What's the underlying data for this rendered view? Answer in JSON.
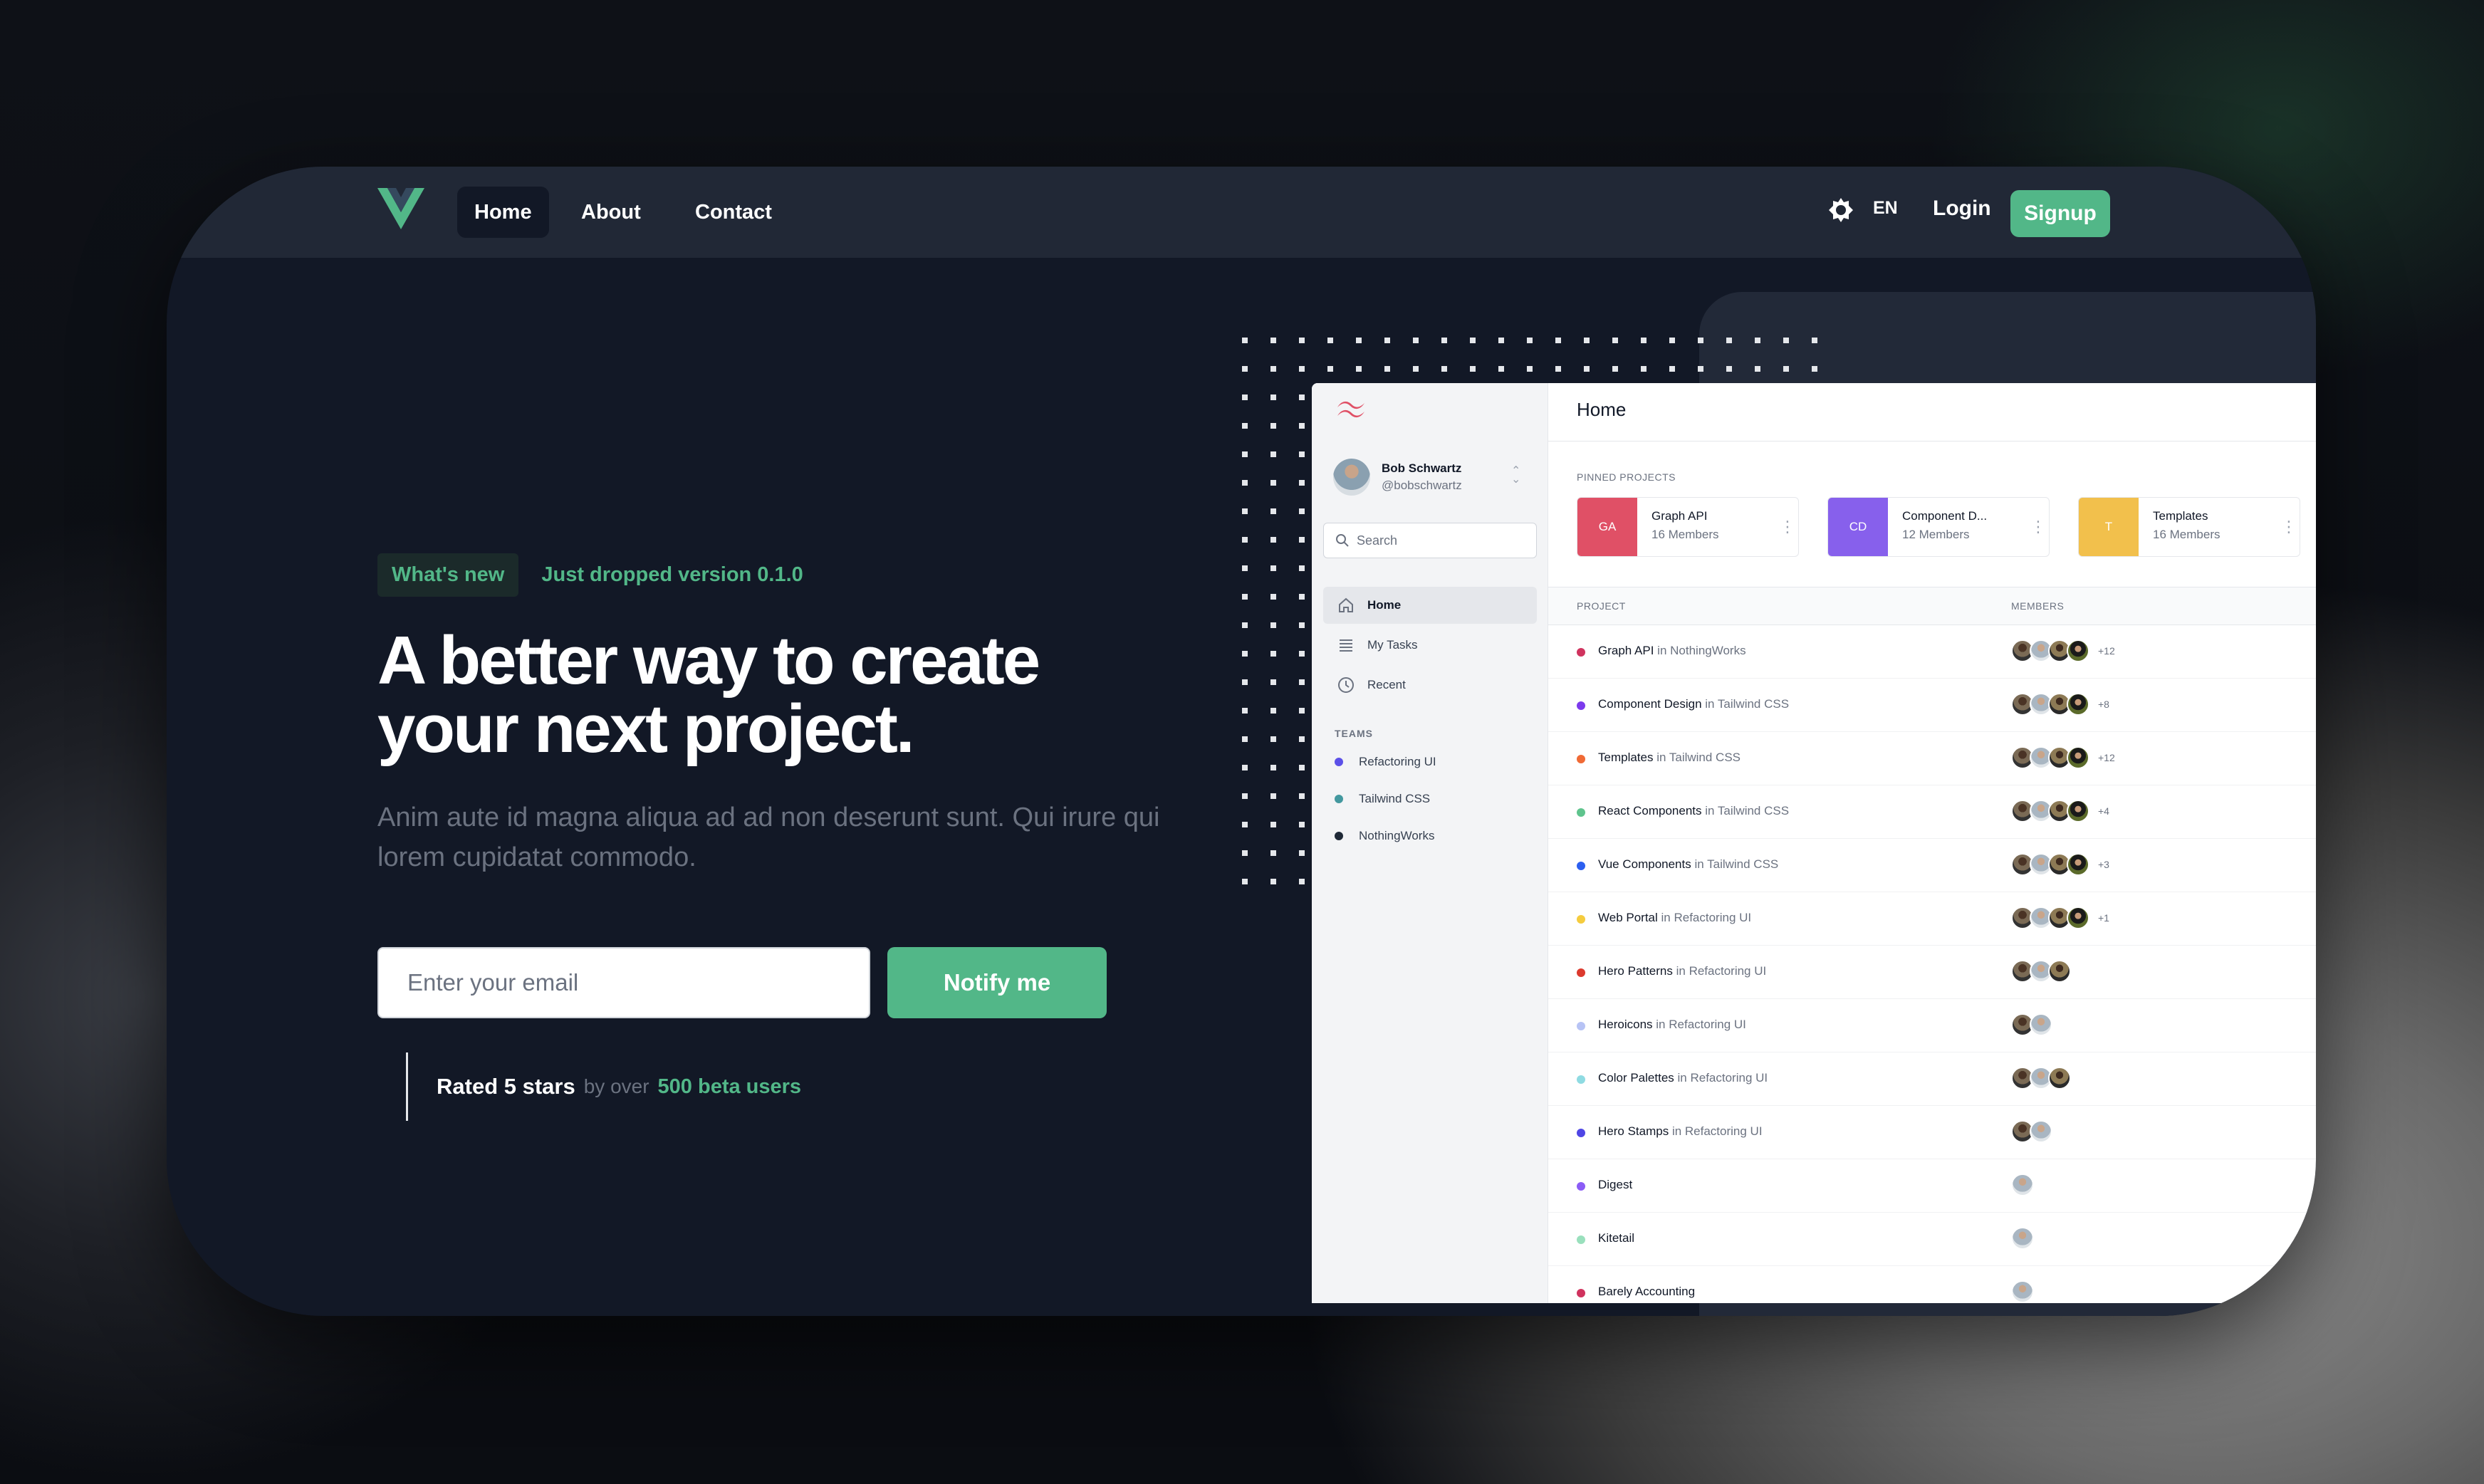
{
  "navbar": {
    "links": [
      {
        "label": "Home",
        "active": true
      },
      {
        "label": "About",
        "active": false
      },
      {
        "label": "Contact",
        "active": false
      }
    ],
    "theme_icon": "sun-icon",
    "language": "EN",
    "login_label": "Login",
    "signup_label": "Signup"
  },
  "hero": {
    "badge": "What's new",
    "badge_text": "Just dropped version 0.1.0",
    "headline": "A better way to create your next project.",
    "subtext": "Anim aute id magna aliqua ad ad non deserunt sunt. Qui irure qui lorem cupidatat commodo.",
    "email_placeholder": "Enter your email",
    "notify_label": "Notify me",
    "rating_strong": "Rated 5 stars",
    "rating_muted": "by over",
    "rating_accent": "500 beta users"
  },
  "colors": {
    "accent": "#52b788",
    "card_bg": "#121826",
    "navbar_bg": "#212836"
  },
  "app": {
    "user": {
      "name": "Bob Schwartz",
      "handle": "@bobschwartz"
    },
    "search_placeholder": "Search",
    "nav": [
      {
        "label": "Home",
        "icon": "home-icon",
        "active": true
      },
      {
        "label": "My Tasks",
        "icon": "list-icon",
        "active": false
      },
      {
        "label": "Recent",
        "icon": "clock-icon",
        "active": false
      }
    ],
    "teams_label": "TEAMS",
    "teams": [
      {
        "name": "Refactoring UI",
        "color": "#5b50e8"
      },
      {
        "name": "Tailwind CSS",
        "color": "#43989f"
      },
      {
        "name": "NothingWorks",
        "color": "#1f2937"
      }
    ],
    "page_title": "Home",
    "pinned_label": "PINNED PROJECTS",
    "pinned": [
      {
        "initials": "GA",
        "name": "Graph API",
        "members": "16 Members",
        "color": "#e05066"
      },
      {
        "initials": "CD",
        "name": "Component D...",
        "members": "12 Members",
        "color": "#8760ec"
      },
      {
        "initials": "T",
        "name": "Templates",
        "members": "16 Members",
        "color": "#f2c04c"
      }
    ],
    "table_headers": {
      "project": "PROJECT",
      "members": "MEMBERS"
    },
    "projects": [
      {
        "name": "Graph API",
        "team": "in NothingWorks",
        "color": "#d0335e",
        "avatars": 4,
        "more": "+12"
      },
      {
        "name": "Component Design",
        "team": "in Tailwind CSS",
        "color": "#7c3aed",
        "avatars": 4,
        "more": "+8"
      },
      {
        "name": "Templates",
        "team": "in Tailwind CSS",
        "color": "#f06a35",
        "avatars": 4,
        "more": "+12"
      },
      {
        "name": "React Components",
        "team": "in Tailwind CSS",
        "color": "#5fc48d",
        "avatars": 4,
        "more": "+4"
      },
      {
        "name": "Vue Components",
        "team": "in Tailwind CSS",
        "color": "#2c5ff0",
        "avatars": 4,
        "more": "+3"
      },
      {
        "name": "Web Portal",
        "team": "in Refactoring UI",
        "color": "#f5cc3e",
        "avatars": 4,
        "more": "+1"
      },
      {
        "name": "Hero Patterns",
        "team": "in Refactoring UI",
        "color": "#dc3a2e",
        "avatars": 3,
        "more": ""
      },
      {
        "name": "Heroicons",
        "team": "in Refactoring UI",
        "color": "#b7c3f5",
        "avatars": 2,
        "more": ""
      },
      {
        "name": "Color Palettes",
        "team": "in Refactoring UI",
        "color": "#8fdbe2",
        "avatars": 3,
        "more": ""
      },
      {
        "name": "Hero Stamps",
        "team": "in Refactoring UI",
        "color": "#4f46e5",
        "avatars": 2,
        "more": ""
      },
      {
        "name": "Digest",
        "team": "",
        "color": "#8b5cf6",
        "avatars": 1,
        "more": ""
      },
      {
        "name": "Kitetail",
        "team": "",
        "color": "#9ae0bd",
        "avatars": 1,
        "more": ""
      },
      {
        "name": "Barely Accounting",
        "team": "",
        "color": "#d0335e",
        "avatars": 1,
        "more": ""
      }
    ]
  }
}
